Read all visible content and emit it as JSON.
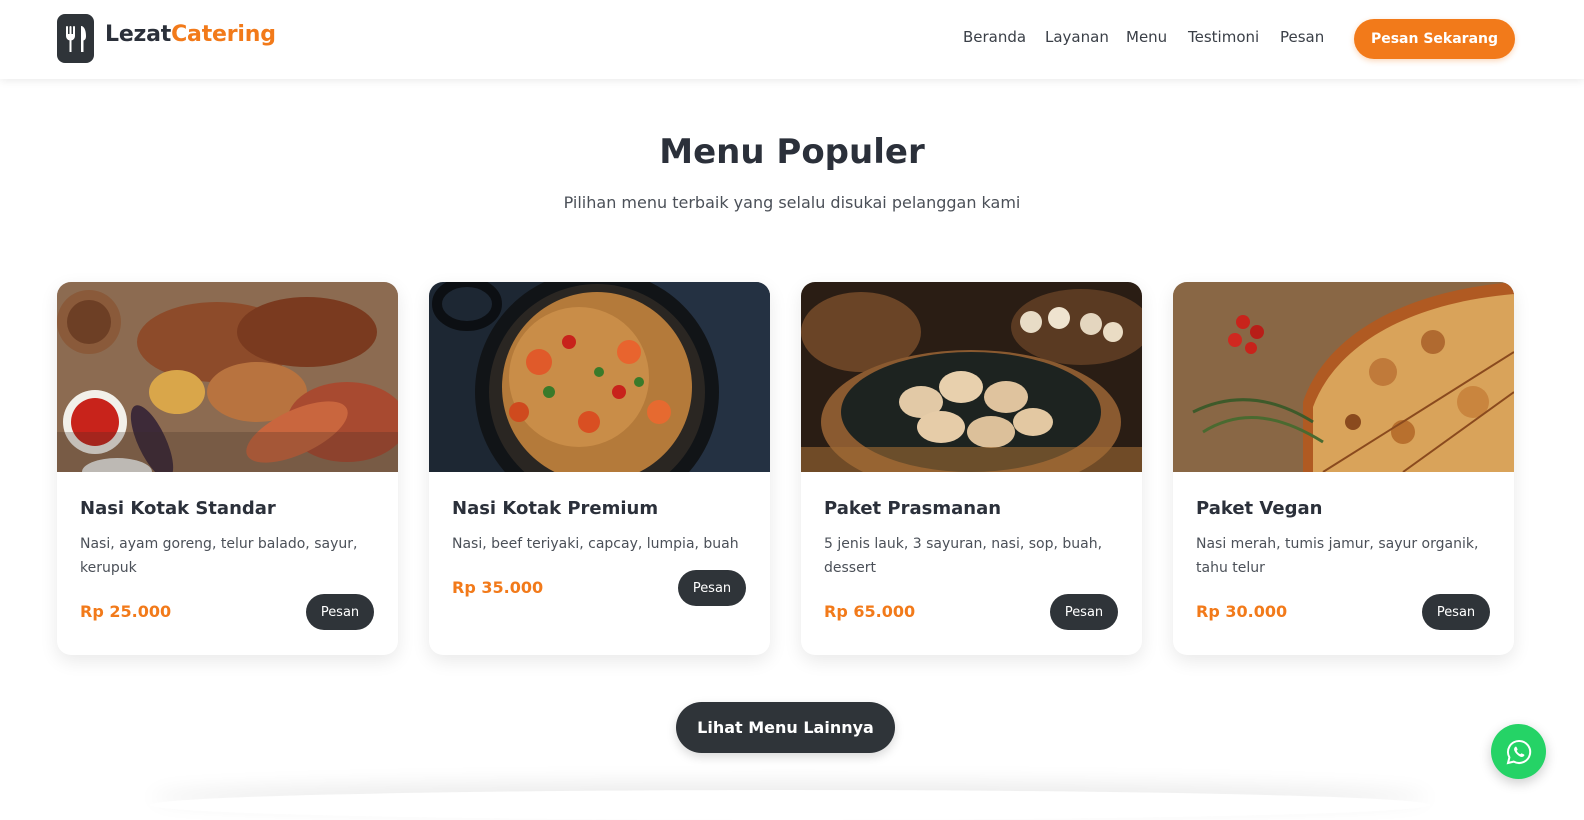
{
  "brand": {
    "name_part1": "Lezat",
    "name_part2": "Catering",
    "icon": "utensils-icon"
  },
  "nav": {
    "items": [
      "Beranda",
      "Layanan",
      "Menu",
      "Testimoni",
      "Pesan"
    ],
    "cta": "Pesan Sekarang"
  },
  "section": {
    "title": "Menu Populer",
    "subtitle": "Pilihan menu terbaik yang selalu disukai pelanggan kami"
  },
  "cards": [
    {
      "name": "Nasi Kotak Standar",
      "desc": "Nasi, ayam goreng, telur balado, sayur, kerupuk",
      "price": "Rp 25.000",
      "button": "Pesan",
      "image": "grilled-meat-platter"
    },
    {
      "name": "Nasi Kotak Premium",
      "desc": "Nasi, beef teriyaki, capcay, lumpia, buah",
      "price": "Rp 35.000",
      "button": "Pesan",
      "image": "seafood-pasta-pan"
    },
    {
      "name": "Paket Prasmanan",
      "desc": "5 jenis lauk, 3 sayuran, nasi, sop, buah, dessert",
      "price": "Rp 65.000",
      "button": "Pesan",
      "image": "dumplings-steamer"
    },
    {
      "name": "Paket Vegan",
      "desc": "Nasi merah, tumis jamur, sayur organik, tahu telur",
      "price": "Rp 30.000",
      "button": "Pesan",
      "image": "pizza-tomatoes"
    }
  ],
  "more_button": "Lihat Menu Lainnya",
  "whatsapp": {
    "icon": "whatsapp-icon"
  },
  "colors": {
    "accent": "#f27a1a",
    "dark": "#2f3439",
    "whatsapp": "#25d366"
  }
}
